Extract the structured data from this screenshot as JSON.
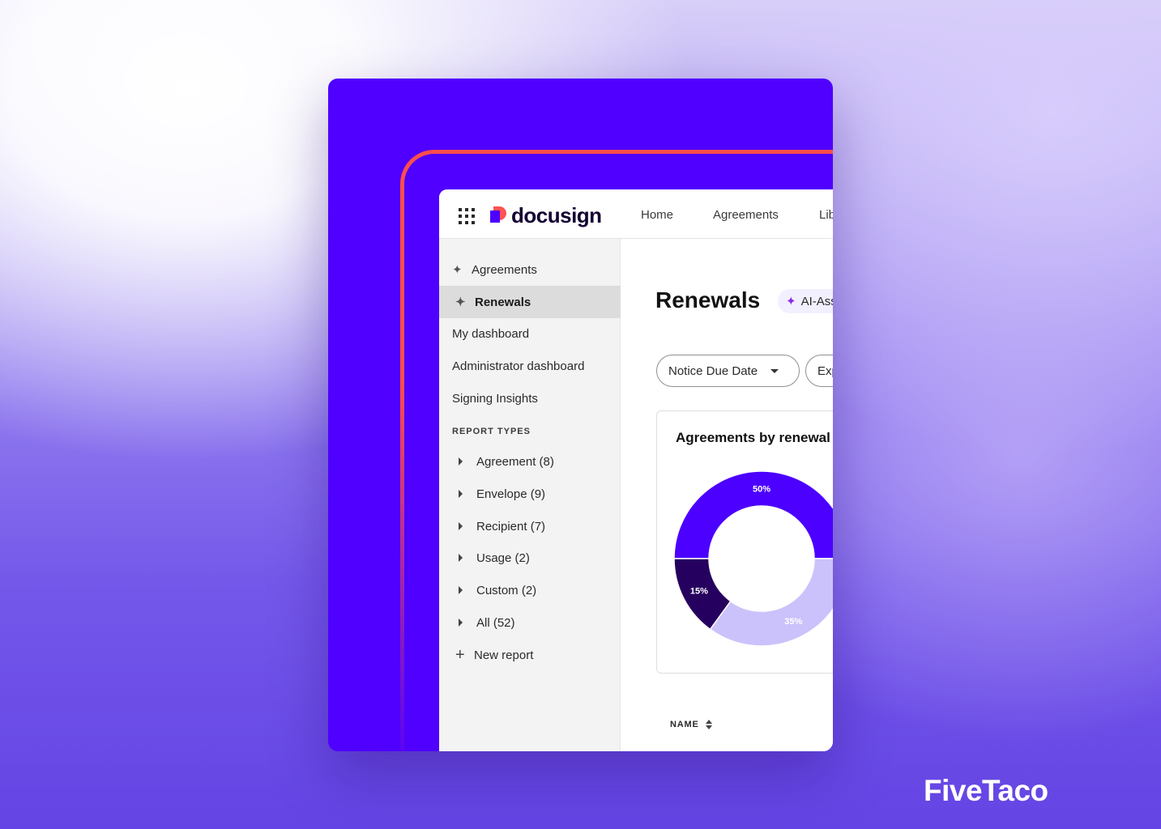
{
  "app": {
    "logo_text": "docusign",
    "nav": [
      "Home",
      "Agreements",
      "Library"
    ]
  },
  "sidebar": {
    "top_items": [
      {
        "label": "Agreements",
        "icon": "sparkle-icon",
        "active": false
      },
      {
        "label": "Renewals",
        "icon": "sparkle-icon",
        "active": true
      },
      {
        "label": "My dashboard"
      },
      {
        "label": "Administrator dashboard"
      },
      {
        "label": "Signing Insights"
      }
    ],
    "section_title": "REPORT TYPES",
    "report_types": [
      {
        "label": "Agreement (8)"
      },
      {
        "label": "Envelope (9)"
      },
      {
        "label": "Recipient (7)"
      },
      {
        "label": "Usage (2)"
      },
      {
        "label": "Custom (2)"
      },
      {
        "label": "All (52)"
      }
    ],
    "new_report": "New report"
  },
  "main": {
    "title": "Renewals",
    "ai_pill": "AI-Assisted",
    "filters": [
      "Notice Due Date",
      "Expiration Date"
    ],
    "chart_title": "Agreements by renewal",
    "table_header_name": "NAME"
  },
  "chart_data": {
    "type": "pie",
    "title": "Agreements by renewal",
    "slices": [
      {
        "label": "50%",
        "value": 50,
        "color": "#4c00ff"
      },
      {
        "label": "35%",
        "value": 35,
        "color": "#cbc2fb"
      },
      {
        "label": "15%",
        "value": 15,
        "color": "#26005e"
      }
    ]
  },
  "brand": "FiveTaco",
  "colors": {
    "card_bg": "#4f00fe",
    "accent_line": "#ff4d4d",
    "sidebar_bg": "#f3f3f3",
    "active_item_bg": "#dcdcdc"
  }
}
